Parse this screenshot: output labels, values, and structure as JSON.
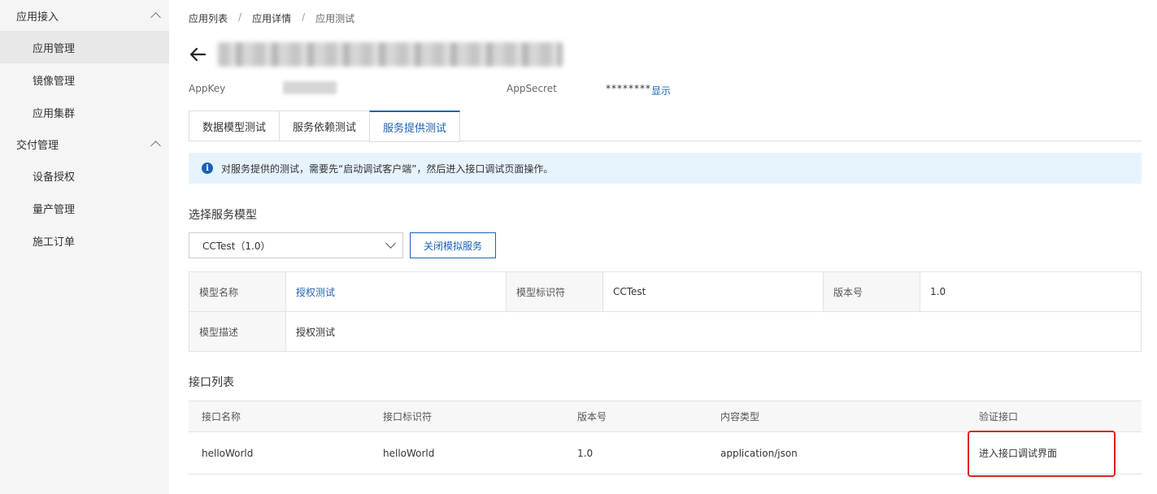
{
  "sidebar": {
    "groups": [
      {
        "label": "应用接入",
        "items": [
          {
            "label": "应用管理"
          },
          {
            "label": "镜像管理"
          },
          {
            "label": "应用集群"
          }
        ]
      },
      {
        "label": "交付管理",
        "items": [
          {
            "label": "设备授权"
          },
          {
            "label": "量产管理"
          },
          {
            "label": "施工订单"
          }
        ]
      }
    ]
  },
  "breadcrumb": [
    "应用列表",
    "应用详情",
    "应用测试"
  ],
  "breadcrumb_sep": "/",
  "app": {
    "appkey_label": "AppKey",
    "appsecret_label": "AppSecret",
    "appsecret_value": "********",
    "show_label": "显示"
  },
  "tabs": [
    {
      "label": "数据模型测试"
    },
    {
      "label": "服务依赖测试"
    },
    {
      "label": "服务提供测试"
    }
  ],
  "notice": {
    "icon": "info-icon",
    "text": "对服务提供的测试，需要先“启动调试客户端”，然后进入接口调试页面操作。"
  },
  "service_model": {
    "title": "选择服务模型",
    "selected": "CCTest（1.0）",
    "close_button": "关闭模拟服务"
  },
  "model_info": {
    "name_label": "模型名称",
    "name_value": "授权测试",
    "id_label": "模型标识符",
    "id_value": "CCTest",
    "version_label": "版本号",
    "version_value": "1.0",
    "desc_label": "模型描述",
    "desc_value": "授权测试"
  },
  "api_list": {
    "title": "接口列表",
    "columns": [
      "接口名称",
      "接口标识符",
      "版本号",
      "内容类型",
      "验证接口"
    ],
    "rows": [
      {
        "name": "helloWorld",
        "identifier": "helloWorld",
        "version": "1.0",
        "content_type": "application/json",
        "action": "进入接口调试界面"
      }
    ]
  },
  "colors": {
    "accent": "#1a62b8",
    "highlight": "#e02020",
    "notice_bg": "#e6f3fd"
  }
}
